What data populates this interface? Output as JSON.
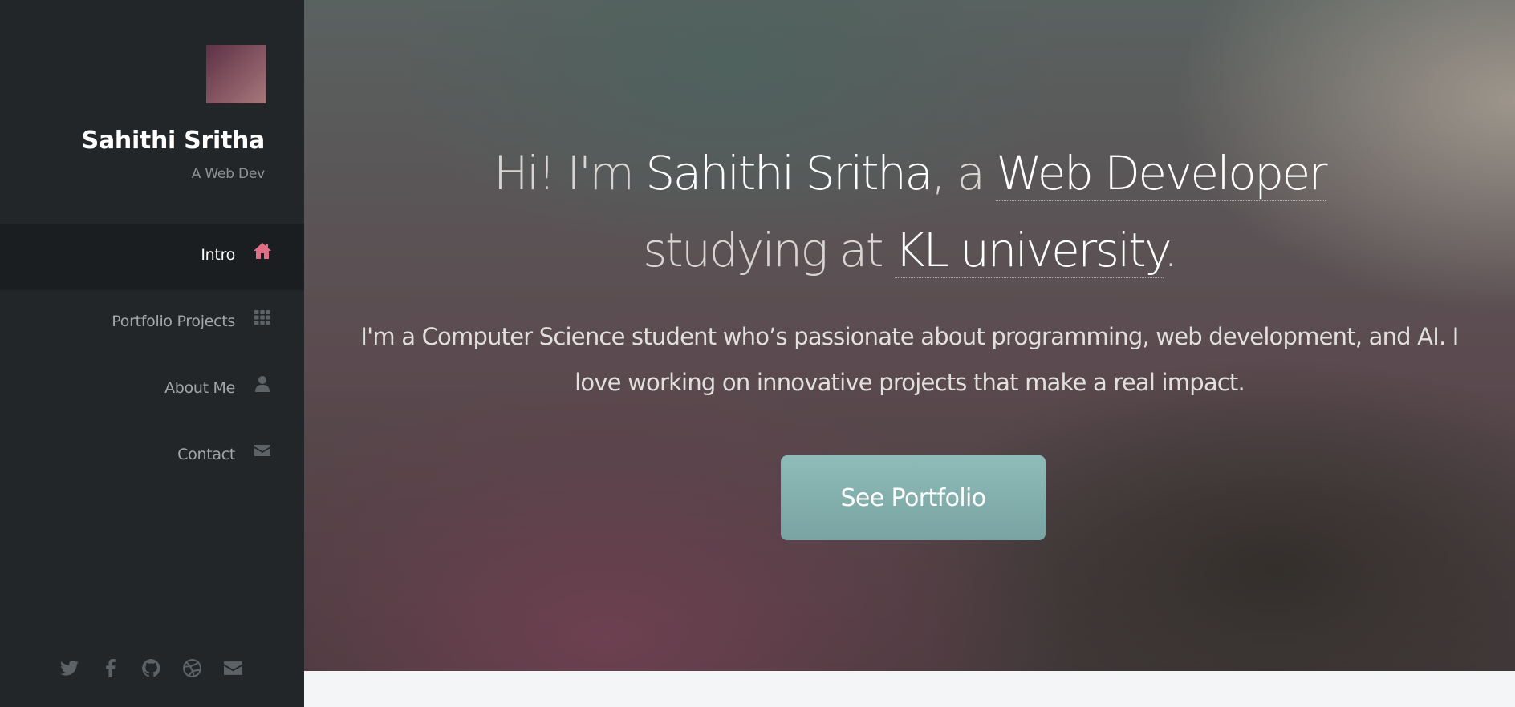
{
  "sidebar": {
    "name": "Sahithi Sritha",
    "tagline": "A Web Dev",
    "nav": [
      {
        "label": "Intro",
        "icon": "home-icon",
        "active": true
      },
      {
        "label": "Portfolio Projects",
        "icon": "grid-icon",
        "active": false
      },
      {
        "label": "About Me",
        "icon": "user-icon",
        "active": false
      },
      {
        "label": "Contact",
        "icon": "envelope-icon",
        "active": false
      }
    ],
    "social": [
      "twitter-icon",
      "facebook-icon",
      "github-icon",
      "dribbble-icon",
      "email-icon"
    ]
  },
  "hero": {
    "line1_prefix": "Hi! I'm ",
    "name": "Sahithi Sritha",
    "line1_mid": ", a ",
    "role": "Web Developer",
    "line2_prefix": "studying at ",
    "school": "KL university",
    "line2_suffix": ".",
    "description": "I'm a Computer Science student who’s passionate about programming, web development, and AI. I love working on innovative projects that make a real impact.",
    "cta_label": "See Portfolio"
  },
  "colors": {
    "sidebar_bg": "#222629",
    "active_nav_bg": "#1b1e21",
    "accent_icon": "#e06f85",
    "muted_icon": "#5d6266",
    "button_bg": "#85b0ae"
  }
}
